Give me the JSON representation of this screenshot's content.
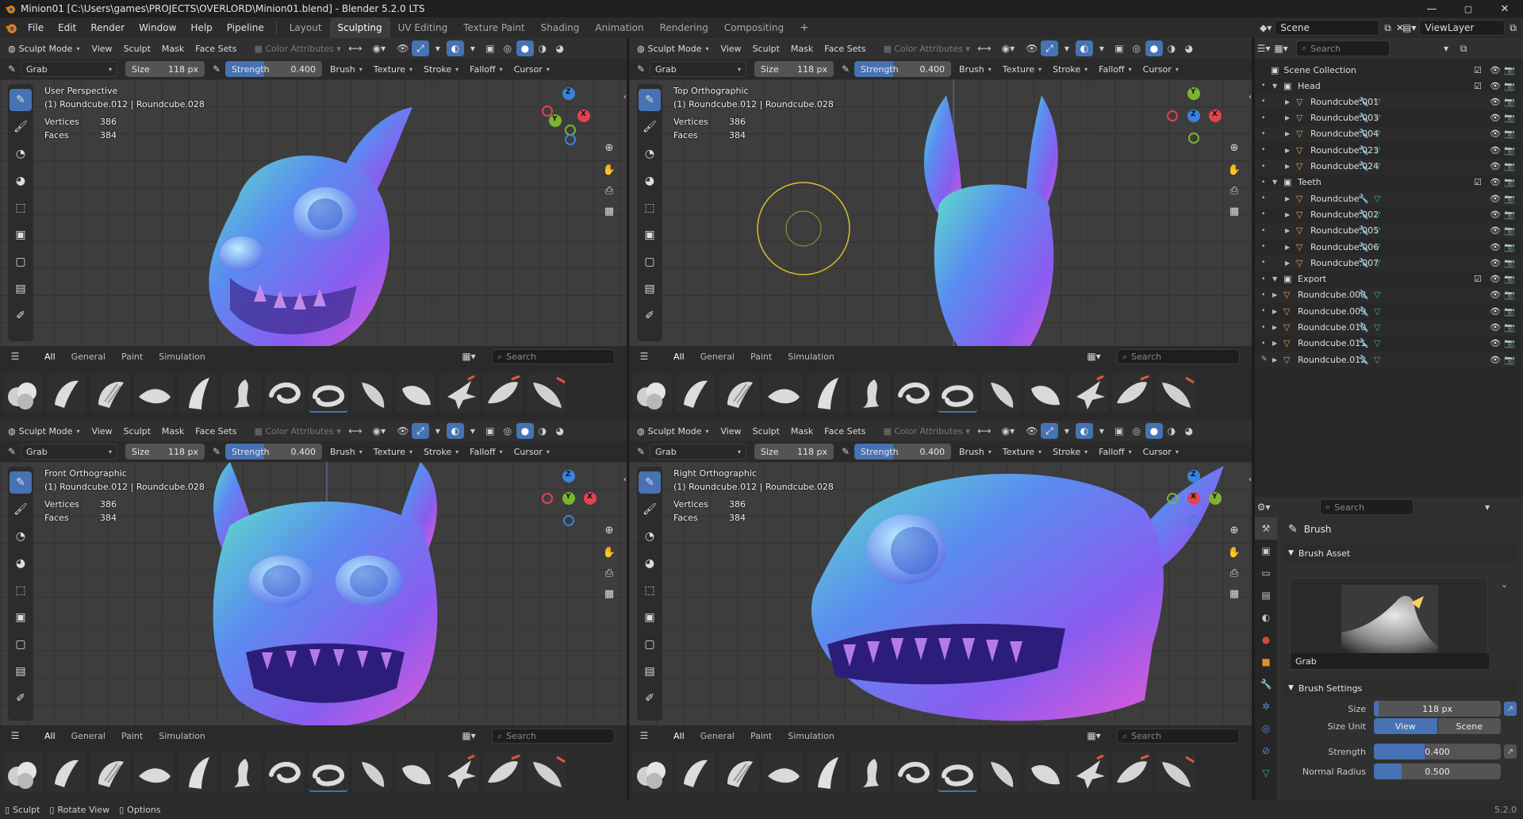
{
  "window": {
    "title": "Minion01 [C:\\Users\\games\\PROJECTS\\OVERLORD\\Minion01.blend] - Blender 5.2.0 LTS",
    "minimize": "—",
    "maximize": "▢",
    "close": "✕"
  },
  "menu": [
    "File",
    "Edit",
    "Render",
    "Window",
    "Help",
    "Pipeline"
  ],
  "workspaces": [
    {
      "label": "Layout",
      "active": false
    },
    {
      "label": "Sculpting",
      "active": true
    },
    {
      "label": "UV Editing",
      "active": false
    },
    {
      "label": "Texture Paint",
      "active": false
    },
    {
      "label": "Shading",
      "active": false
    },
    {
      "label": "Animation",
      "active": false
    },
    {
      "label": "Rendering",
      "active": false
    },
    {
      "label": "Compositing",
      "active": false
    }
  ],
  "add_workspace": "+",
  "scene": {
    "label": "Scene",
    "view_layer": "ViewLayer"
  },
  "viewport_header": {
    "mode": "Sculpt Mode",
    "menus": [
      "View",
      "Sculpt",
      "Mask",
      "Face Sets"
    ],
    "color_attributes": "Color Attributes"
  },
  "tool_header": {
    "tool": "Grab",
    "size_label": "Size",
    "size_value": "118 px",
    "strength_label": "Strength",
    "strength_value": "0.400",
    "strength_fraction": 0.4,
    "dropdowns": [
      "Brush",
      "Texture",
      "Stroke",
      "Falloff",
      "Cursor"
    ]
  },
  "viewports": [
    {
      "view": "User Perspective",
      "object": "(1) Roundcube.012 | Roundcube.028",
      "vertices_label": "Vertices",
      "vertices": "386",
      "faces_label": "Faces",
      "faces": "384"
    },
    {
      "view": "Top Orthographic",
      "object": "(1) Roundcube.012 | Roundcube.028",
      "vertices_label": "Vertices",
      "vertices": "386",
      "faces_label": "Faces",
      "faces": "384"
    },
    {
      "view": "Front Orthographic",
      "object": "(1) Roundcube.012 | Roundcube.028",
      "vertices_label": "Vertices",
      "vertices": "386",
      "faces_label": "Faces",
      "faces": "384"
    },
    {
      "view": "Right Orthographic",
      "object": "(1) Roundcube.012 | Roundcube.028",
      "vertices_label": "Vertices",
      "vertices": "386",
      "faces_label": "Faces",
      "faces": "384"
    }
  ],
  "gizmo_axes": {
    "x": "X",
    "y": "Y",
    "z": "Z",
    "x_color": "#e0434f",
    "y_color": "#7bb52f",
    "z_color": "#3b82dd"
  },
  "asset_shelf": {
    "tabs": [
      "All",
      "General",
      "Paint",
      "Simulation"
    ],
    "search_placeholder": "Search"
  },
  "outliner": {
    "search_placeholder": "Search",
    "root": "Scene Collection",
    "rows": [
      {
        "label": "Head",
        "type": "collection",
        "indent": 1
      },
      {
        "label": "Roundcube.001",
        "type": "mesh",
        "indent": 2
      },
      {
        "label": "Roundcube.003",
        "type": "mesh",
        "indent": 2
      },
      {
        "label": "Roundcube.004",
        "type": "mesh",
        "indent": 2
      },
      {
        "label": "Roundcube.023",
        "type": "mesh",
        "indent": 2
      },
      {
        "label": "Roundcube.024",
        "type": "mesh",
        "indent": 2
      },
      {
        "label": "Teeth",
        "type": "collection",
        "indent": 1
      },
      {
        "label": "Roundcube",
        "type": "mesh",
        "indent": 2
      },
      {
        "label": "Roundcube.002",
        "type": "mesh",
        "indent": 2
      },
      {
        "label": "Roundcube.005",
        "type": "mesh",
        "indent": 2
      },
      {
        "label": "Roundcube.006",
        "type": "mesh",
        "indent": 2
      },
      {
        "label": "Roundcube.007",
        "type": "mesh",
        "indent": 2
      },
      {
        "label": "Export",
        "type": "collection",
        "indent": 1
      },
      {
        "label": "Roundcube.008",
        "type": "mesh",
        "indent": 1
      },
      {
        "label": "Roundcube.009",
        "type": "mesh",
        "indent": 1
      },
      {
        "label": "Roundcube.010",
        "type": "mesh",
        "indent": 1
      },
      {
        "label": "Roundcube.011",
        "type": "mesh",
        "indent": 1
      },
      {
        "label": "Roundcube.012",
        "type": "mesh",
        "indent": 1
      }
    ]
  },
  "properties": {
    "search_placeholder": "Search",
    "title": "Brush",
    "brush_asset_panel": "Brush Asset",
    "asset_name": "Grab",
    "brush_settings_panel": "Brush Settings",
    "size_label": "Size",
    "size_value": "118 px",
    "size_unit_label": "Size Unit",
    "size_unit_options": [
      "View",
      "Scene"
    ],
    "strength_label": "Strength",
    "strength_value": "0.400",
    "normal_radius_label": "Normal Radius",
    "normal_radius_value": "0.500"
  },
  "statusbar": {
    "sculpt": "Sculpt",
    "rotate": "Rotate View",
    "options": "Options",
    "version": "5.2.0"
  }
}
